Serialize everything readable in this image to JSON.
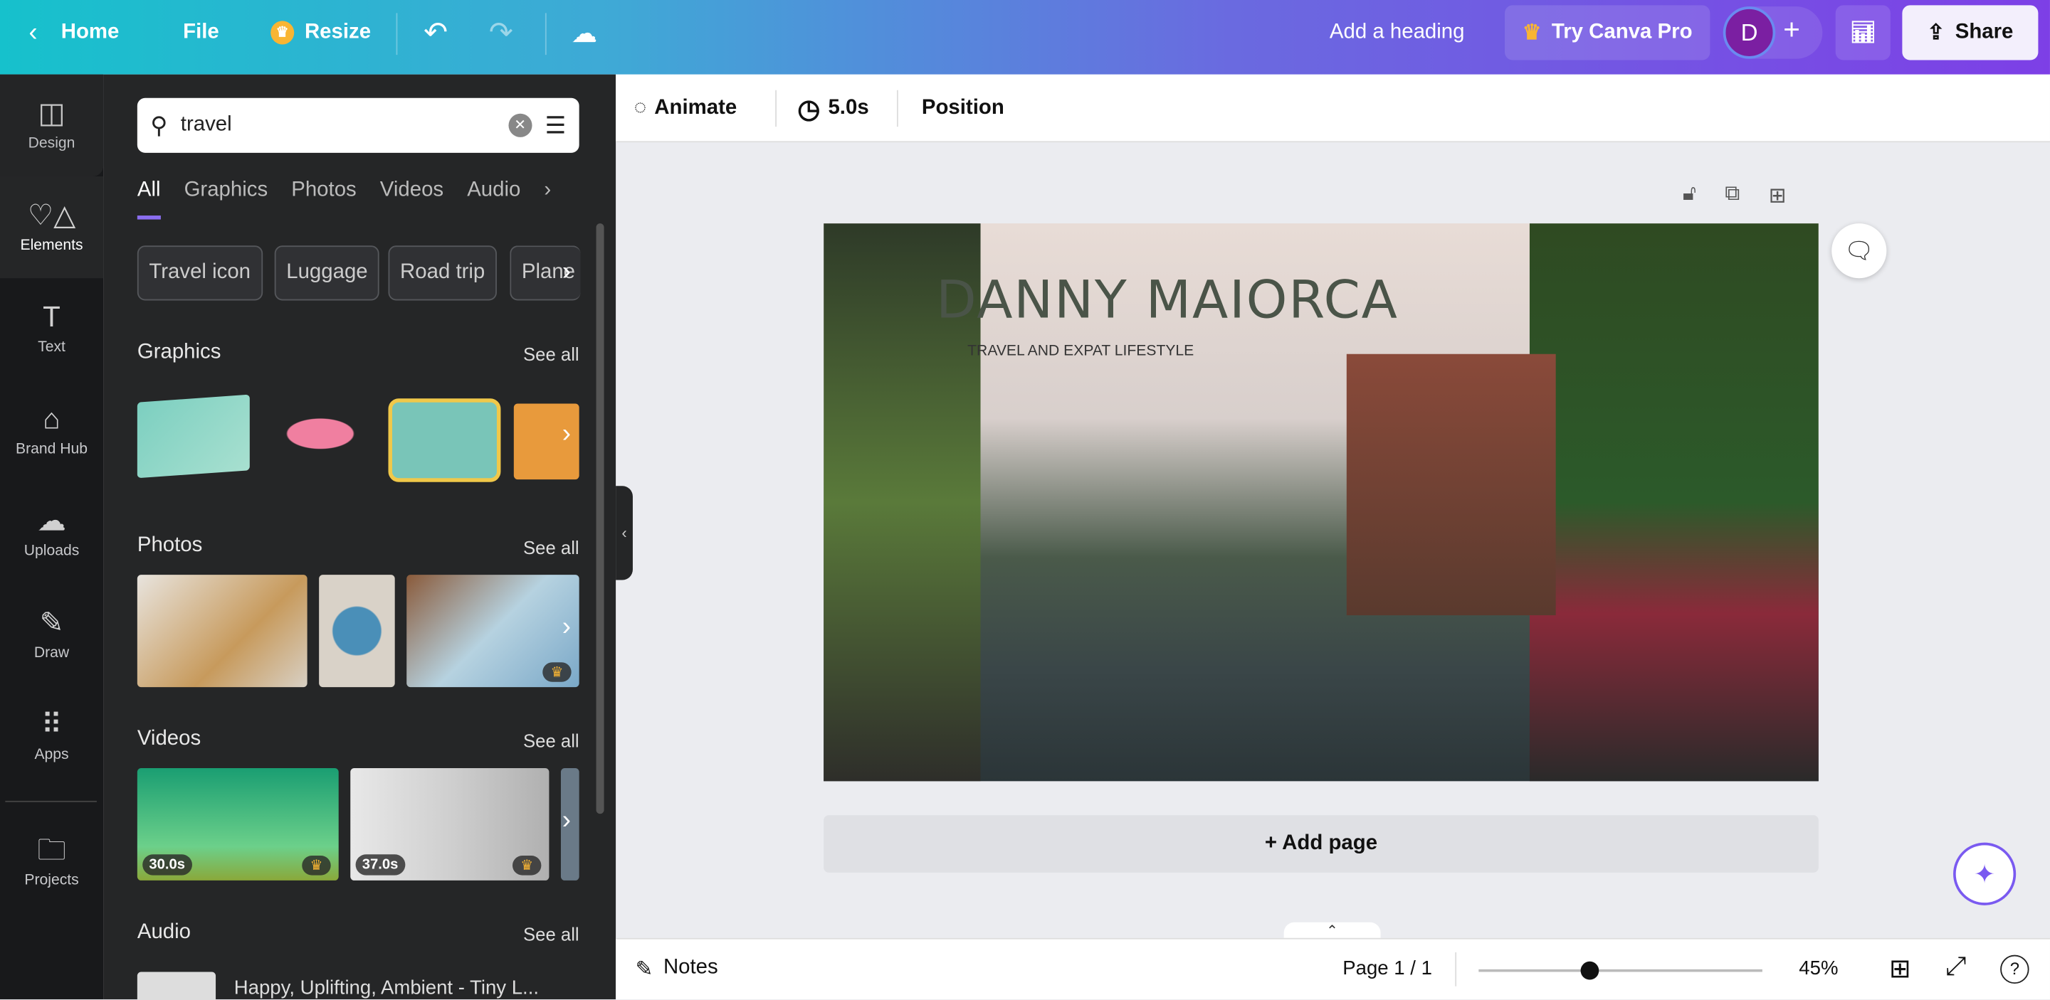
{
  "topbar": {
    "home": "Home",
    "file": "File",
    "resize": "Resize",
    "heading": "Add a heading",
    "try_pro": "Try Canva Pro",
    "avatar": "D",
    "share": "Share"
  },
  "rail": [
    {
      "label": "Design",
      "icon": "layout-icon"
    },
    {
      "label": "Elements",
      "icon": "shapes-icon"
    },
    {
      "label": "Text",
      "icon": "text-icon"
    },
    {
      "label": "Brand Hub",
      "icon": "brand-icon"
    },
    {
      "label": "Uploads",
      "icon": "cloud-upload-icon"
    },
    {
      "label": "Draw",
      "icon": "pen-icon"
    },
    {
      "label": "Apps",
      "icon": "grid-icon"
    },
    {
      "label": "Projects",
      "icon": "folder-icon"
    }
  ],
  "panel": {
    "search_value": "travel",
    "tabs": [
      "All",
      "Graphics",
      "Photos",
      "Videos",
      "Audio"
    ],
    "chips": [
      "Travel icon",
      "Luggage",
      "Road trip",
      "Plane"
    ],
    "sections": {
      "graphics": "Graphics",
      "photos": "Photos",
      "videos": "Videos",
      "audio": "Audio",
      "see_all": "See all"
    },
    "videos": [
      {
        "duration": "30.0s"
      },
      {
        "duration": "37.0s"
      }
    ],
    "audio_title": "Happy, Uplifting, Ambient - Tiny L..."
  },
  "toolbar": {
    "animate": "Animate",
    "duration": "5.0s",
    "position": "Position"
  },
  "design": {
    "title": "DANNY MAIORCA",
    "subtitle": "TRAVEL AND EXPAT LIFESTYLE"
  },
  "add_page": "+ Add page",
  "footer": {
    "notes": "Notes",
    "page": "Page 1 / 1",
    "zoom": "45%",
    "zoom_fraction": 0.39
  }
}
